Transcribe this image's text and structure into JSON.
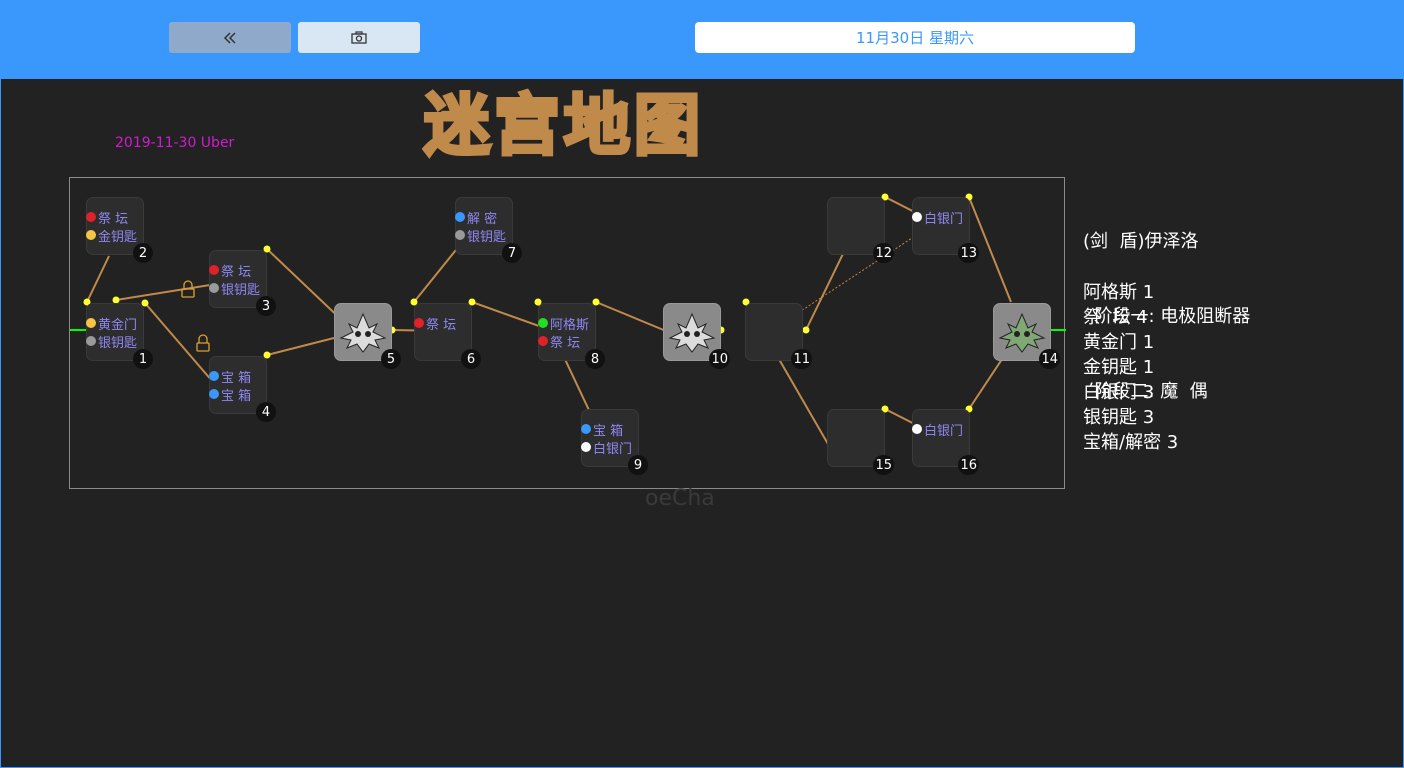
{
  "toolbar": {
    "back_icon": "double-chevron-left-icon",
    "screenshot_icon": "camera-icon",
    "date": "11月30日 星期六"
  },
  "header": {
    "date_label": "2019-11-30 Uber",
    "title": "迷宫地图"
  },
  "colors": {
    "topbar": "#3a97fb",
    "background": "#222222",
    "edge": "#c08a4a",
    "connector": "#ffff33",
    "entry": "#00ff00",
    "date_label": "#d21ad2"
  },
  "map": {
    "watermark": "oeCha",
    "nodes": [
      {
        "id": "1",
        "items": [
          {
            "dot": "#f4c542",
            "label": "黄金门"
          },
          {
            "dot": "#9a9a9a",
            "label": "银钥匙"
          }
        ]
      },
      {
        "id": "2",
        "items": [
          {
            "dot": "#e0202a",
            "label": "祭  坛"
          },
          {
            "dot": "#f4c542",
            "label": "金钥匙"
          }
        ]
      },
      {
        "id": "3",
        "items": [
          {
            "dot": "#e0202a",
            "label": "祭  坛"
          },
          {
            "dot": "#9a9a9a",
            "label": "银钥匙"
          }
        ]
      },
      {
        "id": "4",
        "items": [
          {
            "dot": "#3a97fb",
            "label": "宝  箱"
          },
          {
            "dot": "#3a97fb",
            "label": "宝  箱"
          }
        ]
      },
      {
        "id": "5",
        "items": [],
        "boss": true
      },
      {
        "id": "6",
        "items": [
          {
            "dot": "#e0202a",
            "label": "祭  坛"
          }
        ]
      },
      {
        "id": "7",
        "items": [
          {
            "dot": "#3a97fb",
            "label": "解  密"
          },
          {
            "dot": "#9a9a9a",
            "label": "银钥匙"
          }
        ]
      },
      {
        "id": "8",
        "items": [
          {
            "dot": "#22dd22",
            "label": "阿格斯"
          },
          {
            "dot": "#e0202a",
            "label": "祭  坛"
          }
        ]
      },
      {
        "id": "9",
        "items": [
          {
            "dot": "#3a97fb",
            "label": "宝  箱"
          },
          {
            "dot": "#ffffff",
            "label": "白银门"
          }
        ]
      },
      {
        "id": "10",
        "items": [],
        "boss": true
      },
      {
        "id": "11",
        "items": []
      },
      {
        "id": "12",
        "items": []
      },
      {
        "id": "13",
        "items": [
          {
            "dot": "#ffffff",
            "label": "白银门"
          }
        ]
      },
      {
        "id": "14",
        "items": [],
        "boss": true,
        "final": true
      },
      {
        "id": "15",
        "items": []
      },
      {
        "id": "16",
        "items": [
          {
            "dot": "#ffffff",
            "label": "白银门"
          }
        ]
      }
    ]
  },
  "info": {
    "boss_title": "(剑  盾)伊泽洛",
    "stage1": "  阶段一: 电极阻断器",
    "stage2": "  阶段二: 魔  偶",
    "counts": [
      "阿格斯 1",
      "祭  坛 4",
      "黄金门 1",
      "金钥匙 1",
      "白银门 3",
      "银钥匙 3",
      "宝箱/解密 3"
    ]
  }
}
